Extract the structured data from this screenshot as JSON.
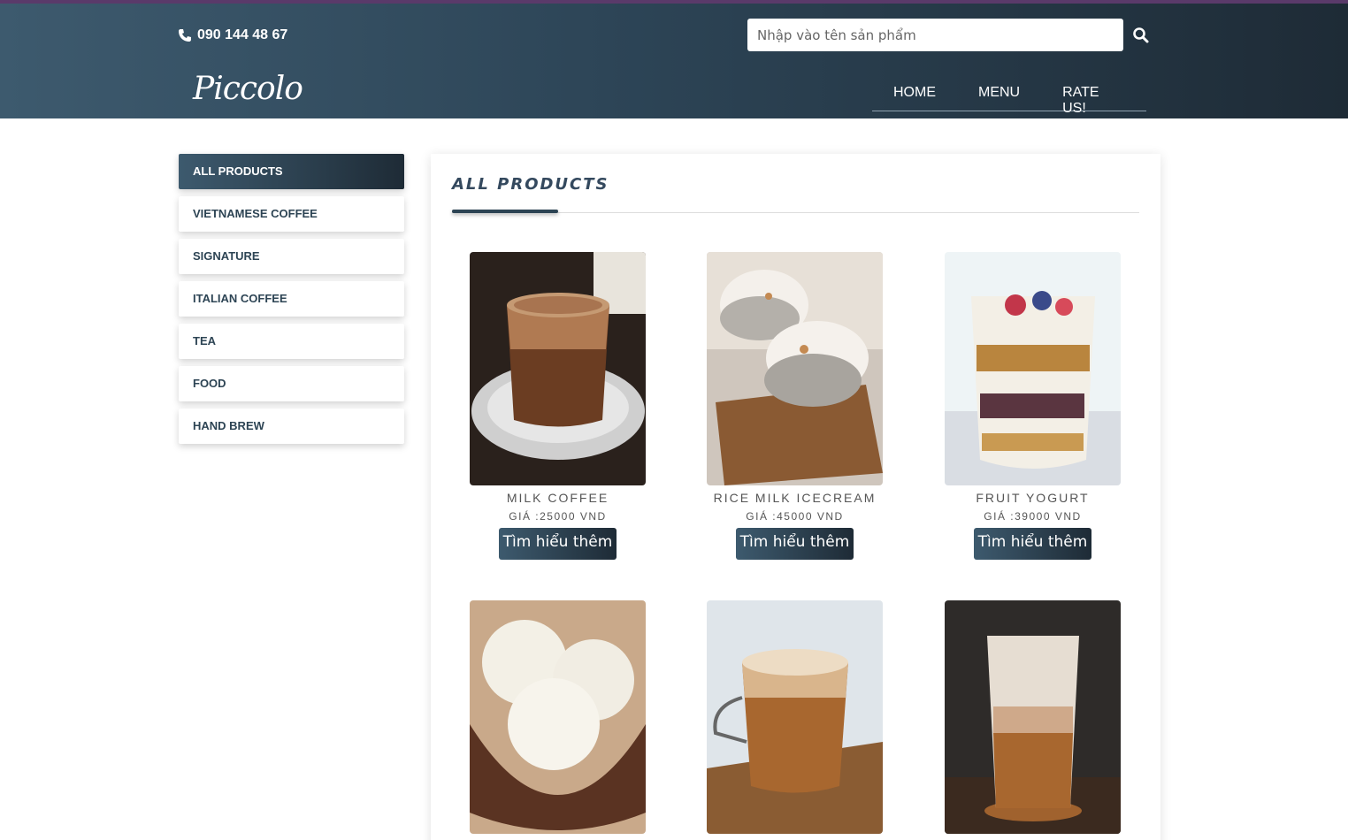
{
  "header": {
    "phone": "090 144 48 67",
    "search_placeholder": "Nhập vào tên sản phẩm",
    "logo": "Piccolo",
    "nav": [
      "HOME",
      "MENU",
      "RATE US!"
    ]
  },
  "sidebar": {
    "items": [
      {
        "label": "ALL PRODUCTS",
        "active": true
      },
      {
        "label": "VIETNAMESE COFFEE",
        "active": false
      },
      {
        "label": "SIGNATURE",
        "active": false
      },
      {
        "label": "ITALIAN COFFEE",
        "active": false
      },
      {
        "label": "TEA",
        "active": false
      },
      {
        "label": "FOOD",
        "active": false
      },
      {
        "label": "HAND BREW",
        "active": false
      }
    ]
  },
  "main": {
    "title": "ALL PRODUCTS",
    "products": [
      {
        "name": "MILK COFFEE",
        "price": "GIÁ :25000 VND",
        "button": "Tìm hiểu thêm",
        "image": "milk-coffee-photo"
      },
      {
        "name": "RICE MILK ICECREAM",
        "price": "GIÁ :45000 VND",
        "button": "Tìm hiểu thêm",
        "image": "rice-milk-icecream-photo"
      },
      {
        "name": "FRUIT YOGURT",
        "price": "GIÁ :39000 VND",
        "button": "Tìm hiểu thêm",
        "image": "fruit-yogurt-photo"
      },
      {
        "image": "coconut-icecream-photo"
      },
      {
        "image": "cappuccino-photo"
      },
      {
        "image": "iced-milk-coffee-photo"
      }
    ]
  },
  "colors": {
    "header_dark": "#1e2b36",
    "header_light": "#3d5a6e",
    "accent_text": "#2d4454"
  }
}
